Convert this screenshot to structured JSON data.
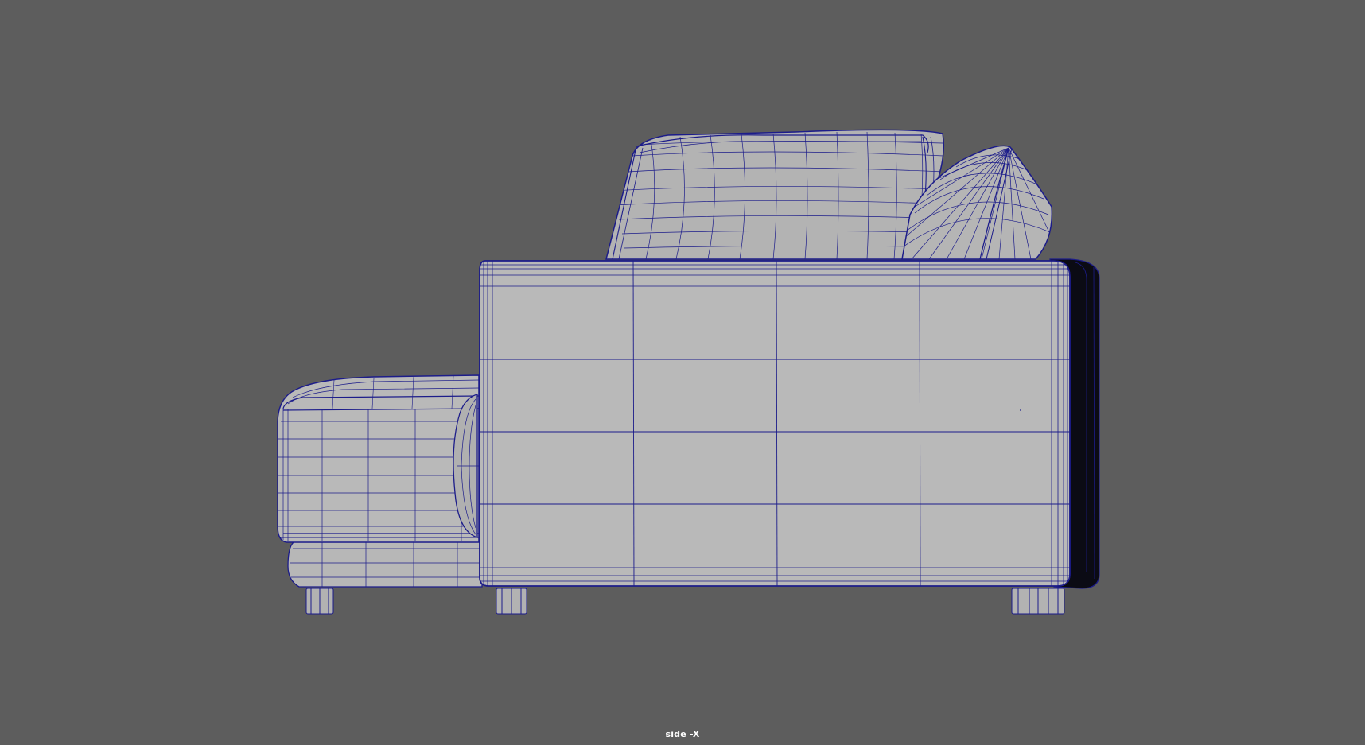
{
  "viewport": {
    "camera_label": "side -X",
    "background_color": "#5d5d5d",
    "shaded_color": "#b9b9b9",
    "wireframe_color": "#1c1c8a",
    "shadow_color": "#0a0a14"
  },
  "scene": {
    "object": "sofa",
    "display_mode": "shaded-wireframe"
  }
}
